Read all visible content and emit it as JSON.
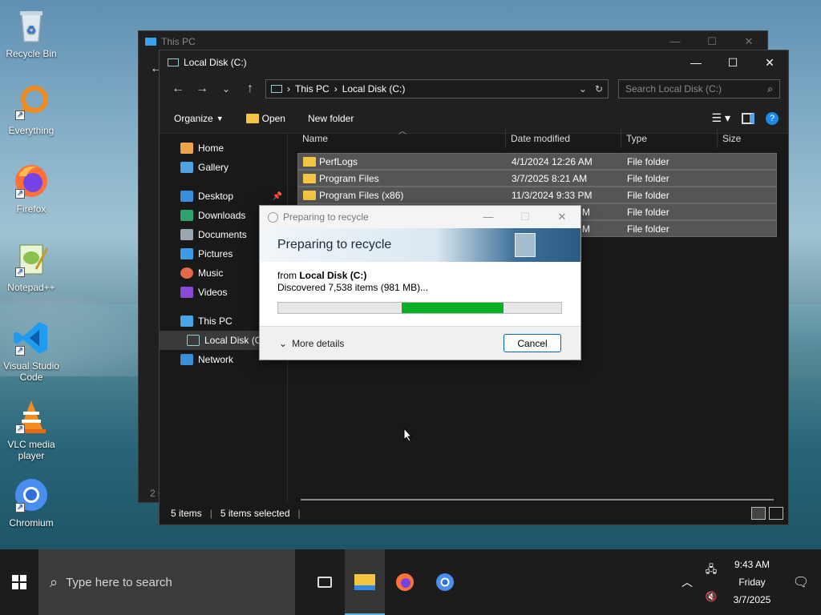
{
  "desktop": {
    "icons": [
      {
        "label": "Recycle Bin"
      },
      {
        "label": "Everything"
      },
      {
        "label": "Firefox"
      },
      {
        "label": "Notepad++"
      },
      {
        "label": "Visual Studio Code"
      },
      {
        "label": "VLC media player"
      },
      {
        "label": "Chromium"
      }
    ]
  },
  "back_window": {
    "title": "This PC",
    "status_fragment": "2 i"
  },
  "explorer": {
    "title": "Local Disk (C:)",
    "breadcrumb": [
      "This PC",
      "Local Disk (C:)"
    ],
    "search_placeholder": "Search Local Disk (C:)",
    "commands": {
      "organize": "Organize",
      "open": "Open",
      "new_folder": "New folder"
    },
    "nav": [
      {
        "label": "Home"
      },
      {
        "label": "Gallery"
      },
      {
        "label": "Desktop"
      },
      {
        "label": "Downloads"
      },
      {
        "label": "Documents"
      },
      {
        "label": "Pictures"
      },
      {
        "label": "Music"
      },
      {
        "label": "Videos"
      },
      {
        "label": "This PC"
      },
      {
        "label": "Local Disk (C:"
      },
      {
        "label": "Network"
      }
    ],
    "columns": {
      "name": "Name",
      "date": "Date modified",
      "type": "Type",
      "size": "Size"
    },
    "rows": [
      {
        "name": "PerfLogs",
        "date": "4/1/2024 12:26 AM",
        "type": "File folder"
      },
      {
        "name": "Program Files",
        "date": "3/7/2025 8:21 AM",
        "type": "File folder"
      },
      {
        "name": "Program Files (x86)",
        "date": "11/3/2024 9:33 PM",
        "type": "File folder"
      },
      {
        "name": "",
        "date": "M",
        "type": "File folder"
      },
      {
        "name": "",
        "date": "M",
        "type": "File folder"
      }
    ],
    "status": {
      "items": "5 items",
      "selected": "5 items selected"
    }
  },
  "dialog": {
    "title": "Preparing to recycle",
    "heading": "Preparing to recycle",
    "from_prefix": "from ",
    "from_source": "Local Disk (C:)",
    "discovered": "Discovered 7,538 items (981 MB)...",
    "progress_fraction": 0.36,
    "more_details": "More details",
    "cancel": "Cancel"
  },
  "taskbar": {
    "search_placeholder": "Type here to search",
    "time": "9:43 AM",
    "day": "Friday",
    "date": "3/7/2025"
  },
  "colors": {
    "accent": "#0067c0",
    "progress": "#06b025",
    "folder": "#f4c542"
  }
}
